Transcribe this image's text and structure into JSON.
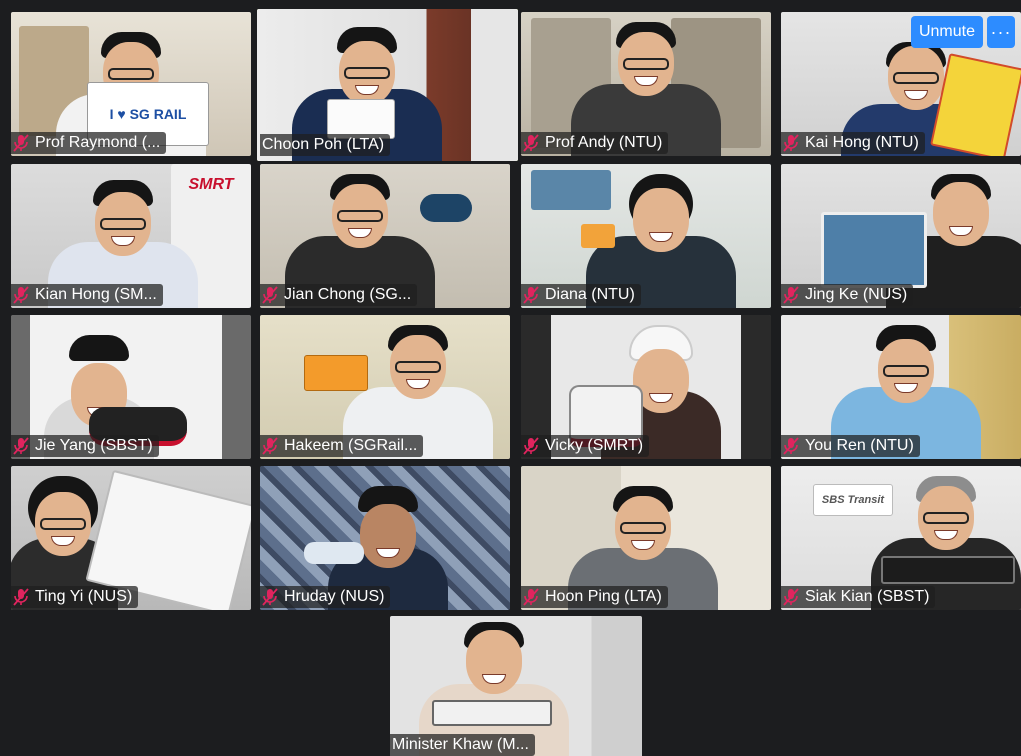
{
  "controls": {
    "unmute_label": "Unmute",
    "more_label": "···"
  },
  "participants": [
    {
      "name": "Prof Raymond (...",
      "sign": "I ♥ SG RAIL"
    },
    {
      "name": "Choon Poh (LTA)"
    },
    {
      "name": "Prof Andy (NTU)"
    },
    {
      "name": "Kai Hong (NTU)"
    },
    {
      "name": "Kian Hong (SM...",
      "banner": "SMRT"
    },
    {
      "name": "Jian Chong (SG..."
    },
    {
      "name": "Diana (NTU)"
    },
    {
      "name": "Jing Ke (NUS)"
    },
    {
      "name": "Jie Yang (SBST)"
    },
    {
      "name": "Hakeem (SGRail..."
    },
    {
      "name": "Vicky (SMRT)"
    },
    {
      "name": "You Ren (NTU)"
    },
    {
      "name": "Ting Yi (NUS)"
    },
    {
      "name": "Hruday (NUS)"
    },
    {
      "name": "Hoon Ping (LTA)"
    },
    {
      "name": "Siak Kian (SBST)",
      "sign": "SBS Transit"
    },
    {
      "name": "Minister Khaw (M..."
    }
  ],
  "colors": {
    "active_border": "#c9e36a",
    "accent": "#2d8cff",
    "muted_icon": "#e0245e"
  }
}
